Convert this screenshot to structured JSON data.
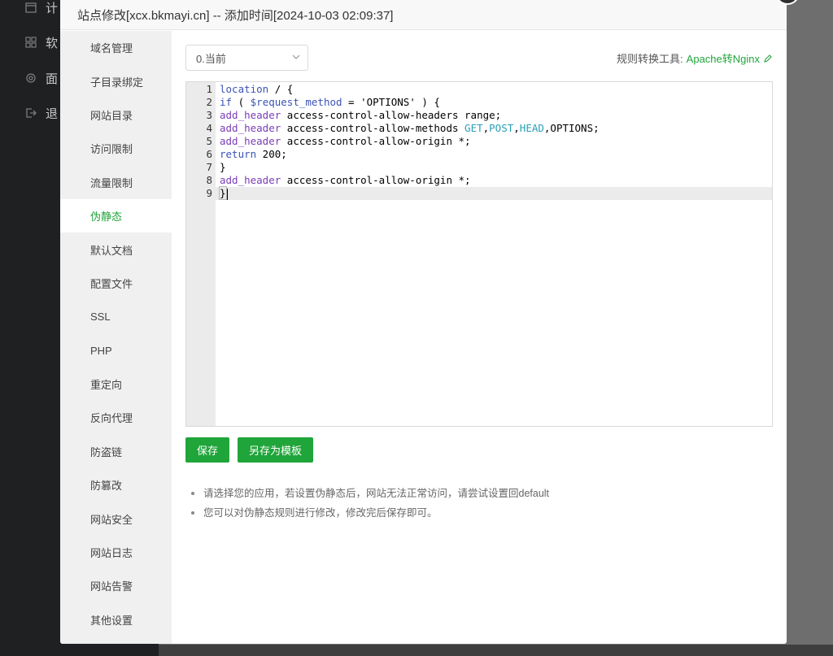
{
  "background": {
    "sidebar_items": [
      {
        "label": "计",
        "icon": "calendar-icon"
      },
      {
        "label": "软",
        "icon": "grid-icon"
      },
      {
        "label": "面",
        "icon": "gear-icon"
      },
      {
        "label": "退",
        "icon": "logout-icon"
      }
    ]
  },
  "modal": {
    "title": "站点修改[xcx.bkmayi.cn] -- 添加时间[2024-10-03 02:09:37]"
  },
  "sidebar": {
    "items": [
      {
        "label": "域名管理"
      },
      {
        "label": "子目录绑定"
      },
      {
        "label": "网站目录"
      },
      {
        "label": "访问限制"
      },
      {
        "label": "流量限制"
      },
      {
        "label": "伪静态",
        "active": true
      },
      {
        "label": "默认文档"
      },
      {
        "label": "配置文件"
      },
      {
        "label": "SSL"
      },
      {
        "label": "PHP"
      },
      {
        "label": "重定向"
      },
      {
        "label": "反向代理"
      },
      {
        "label": "防盗链"
      },
      {
        "label": "防篡改"
      },
      {
        "label": "网站安全"
      },
      {
        "label": "网站日志"
      },
      {
        "label": "网站告警"
      },
      {
        "label": "其他设置"
      }
    ]
  },
  "rewrite": {
    "select_value": "0.当前",
    "tool_label": "规则转换工具:",
    "tool_link": "Apache转Nginx"
  },
  "editor": {
    "lines": [
      {
        "n": "1",
        "text": "location / {"
      },
      {
        "n": "2",
        "text": "if ( $request_method = 'OPTIONS' ) {"
      },
      {
        "n": "3",
        "text": "add_header access-control-allow-headers range;"
      },
      {
        "n": "4",
        "text": "add_header access-control-allow-methods GET,POST,HEAD,OPTIONS;"
      },
      {
        "n": "5",
        "text": "add_header access-control-allow-origin *;"
      },
      {
        "n": "6",
        "text": "return 200;"
      },
      {
        "n": "7",
        "text": "}"
      },
      {
        "n": "8",
        "text": "add_header access-control-allow-origin *;"
      },
      {
        "n": "9",
        "text": "}"
      }
    ],
    "current_line": "9"
  },
  "buttons": {
    "save": "保存",
    "save_as_template": "另存为模板"
  },
  "tips": [
    "请选择您的应用，若设置伪静态后，网站无法正常访问，请尝试设置回default",
    "您可以对伪静态规则进行修改，修改完后保存即可。"
  ],
  "colors": {
    "accent": "#20a53a",
    "sidebar_bg": "#f0f0f0",
    "gutter_bg": "#ebebeb"
  }
}
